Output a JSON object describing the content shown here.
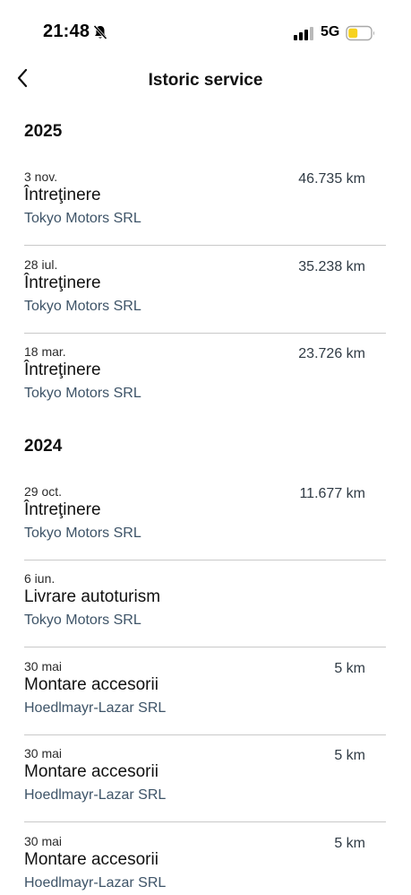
{
  "status_bar": {
    "time": "21:48",
    "network": "5G",
    "battery_color": "#f7d21e"
  },
  "nav": {
    "title": "Istoric service",
    "back_icon": "chevron-left-icon"
  },
  "sections": [
    {
      "year": "2025",
      "records": [
        {
          "date": "3 nov.",
          "type": "Întreţinere",
          "dealer": "Tokyo Motors SRL",
          "km": "46.735 km"
        },
        {
          "date": "28 iul.",
          "type": "Întreţinere",
          "dealer": "Tokyo Motors SRL",
          "km": "35.238 km"
        },
        {
          "date": "18 mar.",
          "type": "Întreţinere",
          "dealer": "Tokyo Motors SRL",
          "km": "23.726 km"
        }
      ]
    },
    {
      "year": "2024",
      "records": [
        {
          "date": "29 oct.",
          "type": "Întreţinere",
          "dealer": "Tokyo Motors SRL",
          "km": "11.677 km"
        },
        {
          "date": "6 iun.",
          "type": "Livrare autoturism",
          "dealer": "Tokyo Motors SRL",
          "km": ""
        },
        {
          "date": "30 mai",
          "type": "Montare accesorii",
          "dealer": "Hoedlmayr-Lazar SRL",
          "km": "5 km"
        },
        {
          "date": "30 mai",
          "type": "Montare accesorii",
          "dealer": "Hoedlmayr-Lazar SRL",
          "km": "5 km"
        },
        {
          "date": "30 mai",
          "type": "Montare accesorii",
          "dealer": "Hoedlmayr-Lazar SRL",
          "km": "5 km"
        }
      ]
    }
  ],
  "colors": {
    "dealer_text": "#3e5468",
    "divider": "#c9c9c9"
  }
}
